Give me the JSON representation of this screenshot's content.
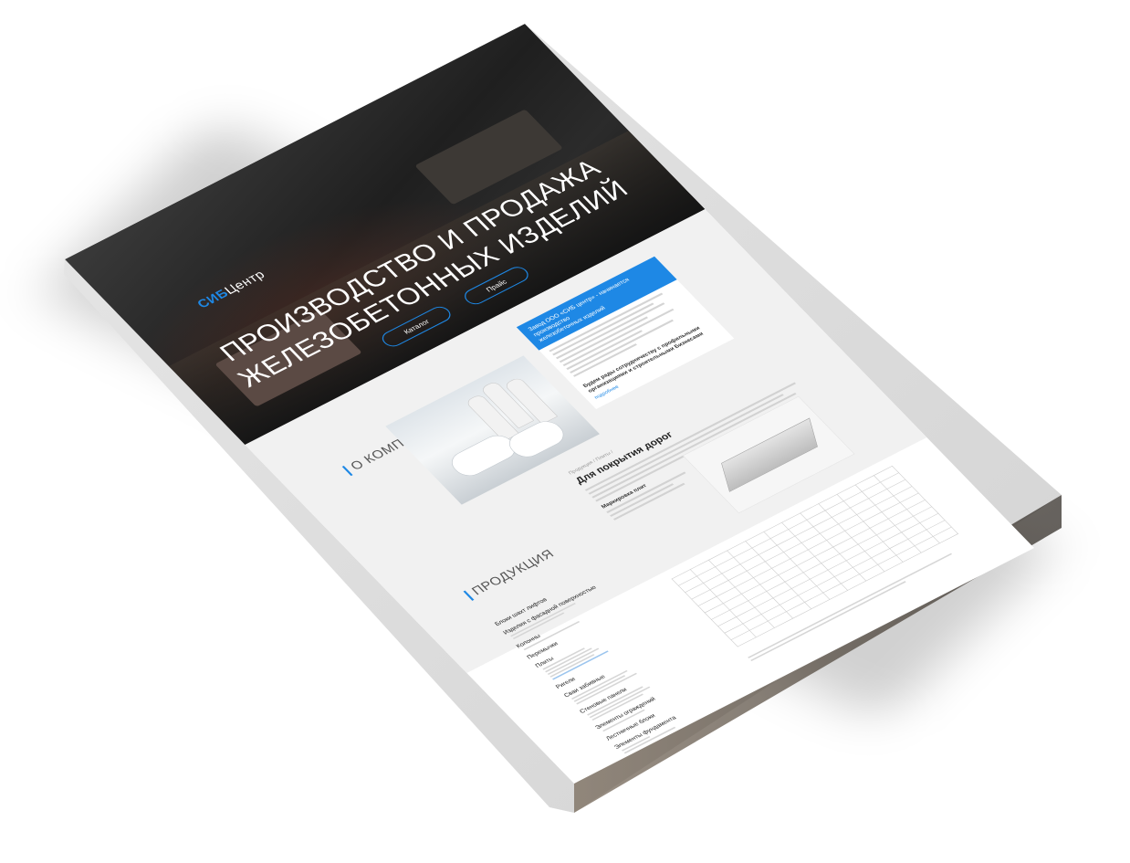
{
  "site": {
    "logo": {
      "accent": "СИБ",
      "rest": "Центр"
    },
    "nav": [
      "",
      "",
      "",
      "",
      ""
    ],
    "phone": {
      "line1": "",
      "line2": ""
    }
  },
  "hero": {
    "title_line1": "ПРОИЗВОДСТВО И ПРОДАЖА",
    "title_line2": "ЖЕЛЕЗОБЕТОННЫХ ИЗДЕЛИЙ",
    "button_catalog": "Каталог",
    "button_price": "Прайс"
  },
  "about": {
    "title": "О КОМПАНИИ",
    "box_head_line1": "Завод ООО «СИБ центр» - начинается производство",
    "box_head_line2": "железобетонных изделий",
    "box_foot_line1": "Будем рады сотрудничеству с профильными",
    "box_foot_line2": "организациями и строительными Бизнесами",
    "box_link": "подробнее"
  },
  "products": {
    "title": "ПРОДУКЦИЯ",
    "menu": [
      {
        "label": "Блоки шахт лифтов"
      },
      {
        "label": "Изделия с фасадной поверхностью"
      },
      {
        "label": "Колонны"
      },
      {
        "label": "Перемычки"
      },
      {
        "label": "Плиты"
      },
      {
        "label": "Ригели"
      },
      {
        "label": "Сваи забивные"
      },
      {
        "label": "Стеновые панели"
      },
      {
        "label": "Элементы ограждений"
      },
      {
        "label": "Лестничные блоки"
      },
      {
        "label": "Элементы фундамента"
      },
      {
        "label": "Малые архитектурные формы"
      }
    ]
  },
  "detail": {
    "crumb": "Продукция / Плиты /",
    "title": "Для покрытия дорог",
    "spec_label": "Маркировка плит"
  }
}
